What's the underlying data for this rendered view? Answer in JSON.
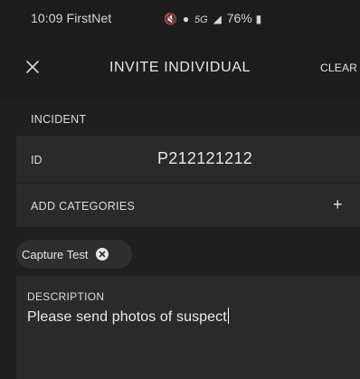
{
  "status_bar": {
    "time": "10:09",
    "carrier": "FirstNet",
    "network": "5G",
    "battery": "76%"
  },
  "app_bar": {
    "title": "INVITE INDIVIDUAL",
    "clear_label": "CLEAR"
  },
  "incident": {
    "section_label": "INCIDENT",
    "id_label": "ID",
    "id_value": "P212121212",
    "add_categories_label": "ADD CATEGORIES",
    "add_icon": "plus-icon"
  },
  "categories": [
    {
      "label": "Capture Test"
    }
  ],
  "description": {
    "label": "DESCRIPTION",
    "value": "Please send photos of suspect"
  }
}
